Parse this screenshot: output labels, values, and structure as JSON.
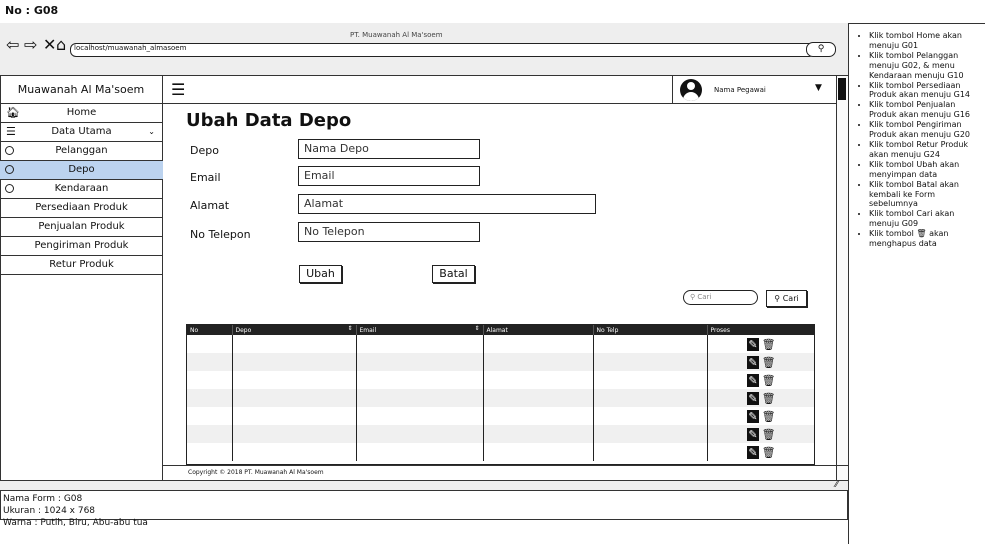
{
  "frame": {
    "no": "No : G08"
  },
  "browser": {
    "title": "PT. Muawanah Al Ma'soem",
    "address": "localhost/muawanah_almasoem",
    "search_icon": "search-icon"
  },
  "app": {
    "brand": "Muawanah Al Ma'soem",
    "user_name": "Nama Pegawai"
  },
  "sidebar": {
    "items": [
      {
        "label": "Home",
        "icon": "home-icon"
      },
      {
        "label": "Data Utama",
        "icon": "database-icon"
      },
      {
        "label": "Pelanggan"
      },
      {
        "label": "Depo",
        "active": true
      },
      {
        "label": "Kendaraan"
      },
      {
        "label": "Persediaan Produk"
      },
      {
        "label": "Penjualan Produk"
      },
      {
        "label": "Pengiriman Produk"
      },
      {
        "label": "Retur Produk"
      }
    ]
  },
  "page": {
    "title": "Ubah Data Depo",
    "fields": [
      {
        "label": "Depo",
        "placeholder": "Nama Depo"
      },
      {
        "label": "Email",
        "placeholder": "Email"
      },
      {
        "label": "Alamat",
        "placeholder": "Alamat"
      },
      {
        "label": "No Telepon",
        "placeholder": "No Telepon"
      }
    ],
    "buttons": {
      "save": "Ubah",
      "cancel": "Batal"
    },
    "search": {
      "placeholder": "Cari",
      "button": "Cari"
    }
  },
  "table": {
    "columns": [
      "No",
      "Depo",
      "Email",
      "Alamat",
      "No Telp",
      "Proses"
    ],
    "row_count": 7,
    "action_icons": [
      "edit-icon",
      "trash-icon"
    ]
  },
  "footer": {
    "copyright": "Copyright © 2018 PT. Muawanah Al Ma'soem"
  },
  "info": {
    "form": "Nama Form : G08",
    "size": "Ukuran : 1024 x 768",
    "color": "Warna : Putih, Biru, Abu-abu tua"
  },
  "notes": [
    "Klik tombol Home akan menuju G01",
    "Klik tombol Pelanggan menuju G02, & menu Kendaraan menuju G10",
    "Klik tombol Persediaan Produk akan menuju G14",
    "Klik tombol Penjualan Produk akan menuju G16",
    "Klik tombol Pengiriman Produk akan menuju G20",
    "Klik tombol Retur Produk akan menuju G24",
    "Klik tombol Ubah akan menyimpan data",
    "Klik tombol Batal akan kembali ke Form sebelumnya",
    "Klik tombol Cari akan menuju G09",
    "Klik tombol 🗑 akan menghapus data"
  ],
  "colors": {
    "active": "#bcd3ef",
    "dark": "#222222"
  }
}
